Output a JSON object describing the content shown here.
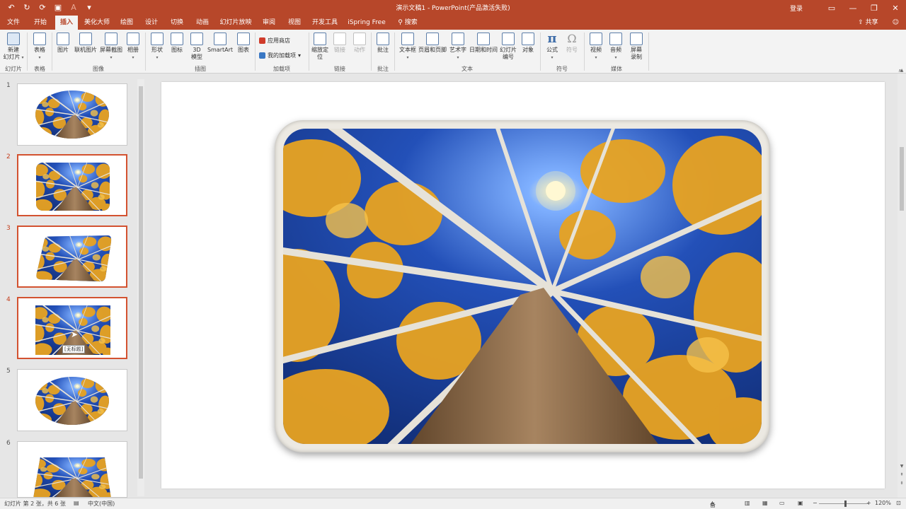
{
  "titlebar": {
    "title": "演示文稿1 - PowerPoint(产品激活失败)",
    "login": "登录",
    "qat_icons": [
      "undo-icon",
      "redo-icon",
      "repeat-icon",
      "save-icon",
      "font-color-icon",
      "customize-icon"
    ]
  },
  "tabs": [
    "文件",
    "开始",
    "插入",
    "美化大师",
    "绘图",
    "设计",
    "切换",
    "动画",
    "幻灯片放映",
    "审阅",
    "视图",
    "开发工具",
    "iSpring Free",
    "搜索"
  ],
  "share": "共享",
  "ribbon": {
    "buttons": {
      "new_slide": "新建\n幻灯片",
      "table": "表格",
      "picture": "图片",
      "online_picture": "联机图片",
      "screenshot": "屏幕截图",
      "album": "相册",
      "shapes": "形状",
      "icons": "图标",
      "model3d": "3D\n模型",
      "smartart": "SmartArt",
      "chart": "图表",
      "store": "应用商店",
      "my_addins": "我的加载项",
      "zoom": "缩放定\n位",
      "link": "链接",
      "action": "动作",
      "comment": "批注",
      "textbox": "文本框",
      "header_footer": "页眉和页脚",
      "wordart": "艺术字",
      "datetime": "日期和时间",
      "slide_number": "幻灯片\n编号",
      "object": "对象",
      "equation": "公式",
      "symbol": "符号",
      "video": "视频",
      "audio": "音频",
      "screen_recording": "屏幕\n录制"
    },
    "groups": {
      "slides": "幻灯片",
      "tables": "表格",
      "images": "图像",
      "illustrations": "插图",
      "addins": "加载项",
      "links": "链接",
      "comments": "批注",
      "text": "文本",
      "symbols": "符号",
      "media": "媒体"
    }
  },
  "slides": [
    {
      "number": "1",
      "shape": "oval"
    },
    {
      "number": "2",
      "shape": "rounded-rect"
    },
    {
      "number": "3",
      "shape": "skewed-rounded"
    },
    {
      "number": "4",
      "shape": "rect"
    },
    {
      "number": "5",
      "shape": "oval"
    },
    {
      "number": "6",
      "shape": "trapezoid"
    }
  ],
  "selected_slides": [
    "2",
    "3",
    "4"
  ],
  "tooltip": "[无标题]",
  "status": {
    "slide_info": "幻灯片 第 2 张，共 6 张",
    "language": "中文(中国)",
    "notes": "备注",
    "zoom": "120%",
    "zoom_level_percent": 120
  },
  "colors": {
    "accent": "#b7472a",
    "selection": "#d35230",
    "sky": "#1a3f9a",
    "foliage": "#e8a321",
    "bark": "#8a6a48"
  }
}
